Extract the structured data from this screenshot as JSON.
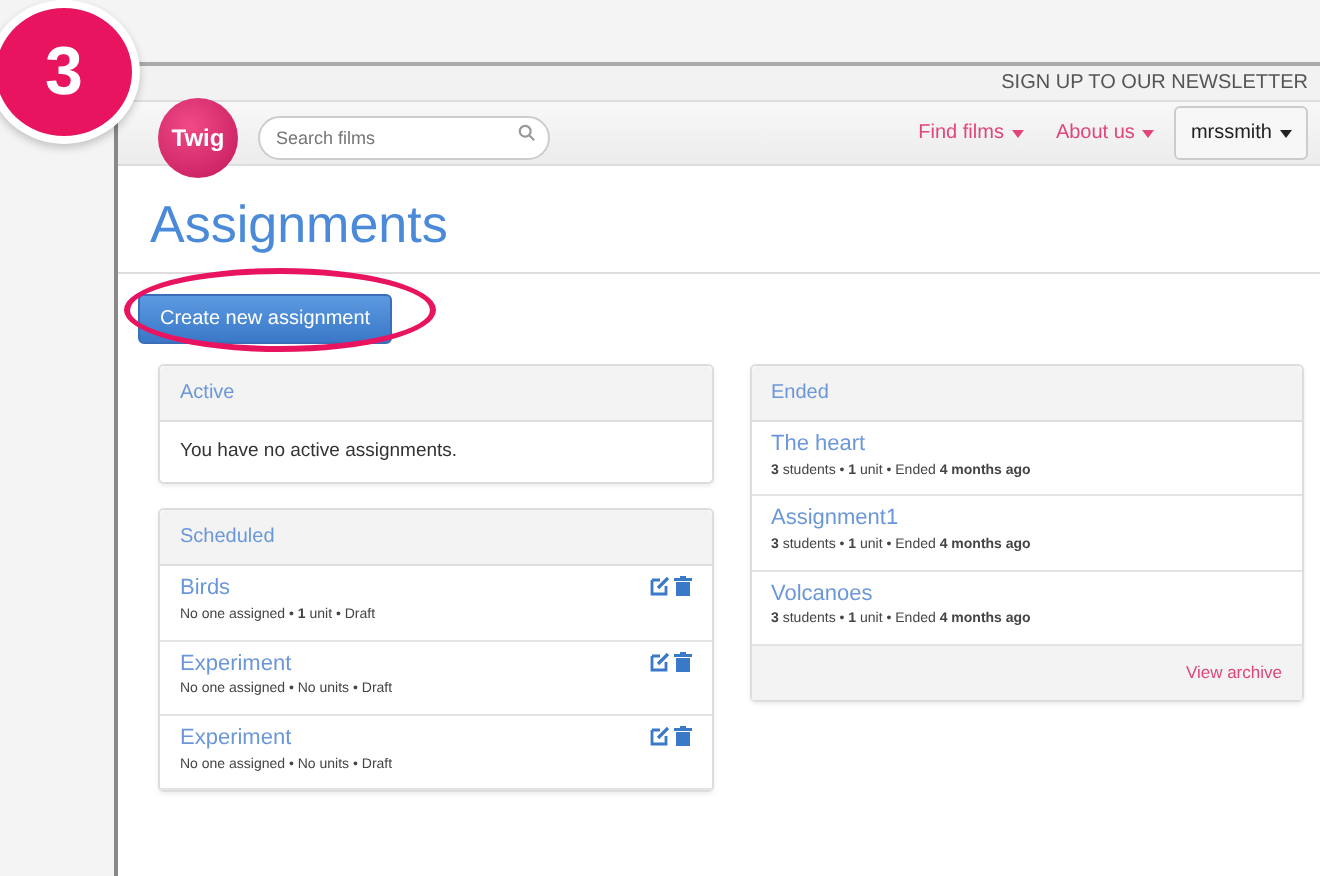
{
  "step_badge": "3",
  "topbar": {
    "newsletter_link": "SIGN UP TO OUR NEWSLETTER"
  },
  "navbar": {
    "logo": "Twig",
    "search": {
      "placeholder": "Search films"
    },
    "menus": [
      "Find films",
      "About us"
    ],
    "user_menu": "mrssmith"
  },
  "page_title": "Assignments",
  "create_button": "Create new assignment",
  "active_panel": {
    "heading": "Active",
    "message": "You have no active assignments."
  },
  "scheduled_panel": {
    "heading": "Scheduled",
    "items": [
      {
        "title": "Birds",
        "meta": "No one assigned • **1** unit • Draft"
      },
      {
        "title": "Experiment",
        "meta": "No one assigned • No units • Draft"
      },
      {
        "title": "Experiment",
        "meta": "No one assigned • No units • Draft"
      }
    ]
  },
  "ended_panel": {
    "heading": "Ended",
    "items": [
      {
        "title": "The heart",
        "meta": "**3** students • **1** unit • Ended **4 months ago**"
      },
      {
        "title": "Assignment1",
        "meta": "**3** students • **1** unit • Ended **4 months ago**"
      },
      {
        "title": "Volcanoes",
        "meta": "**3** students • **1** unit • Ended **4 months ago**"
      }
    ],
    "footer_link": "View archive"
  }
}
